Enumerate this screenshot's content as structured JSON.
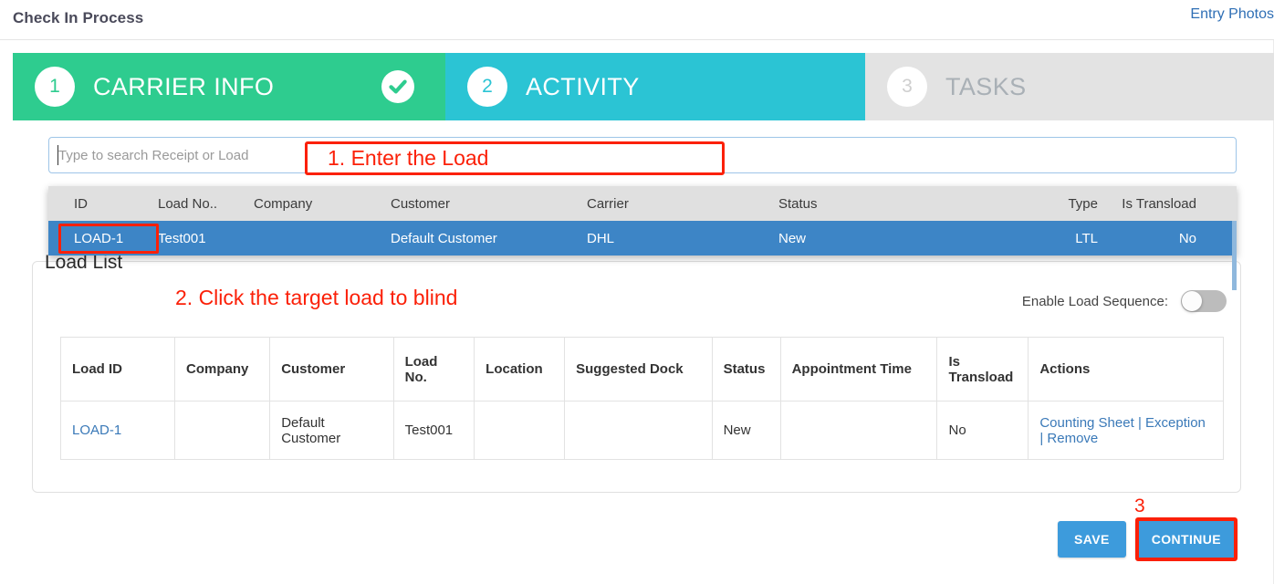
{
  "header": {
    "title": "Check In Process",
    "entry_photos_label": "Entry Photos"
  },
  "steps": [
    {
      "number": "1",
      "label": "CARRIER INFO",
      "state": "completed",
      "color": "#2ecc8f",
      "check_icon": "check-circle-icon"
    },
    {
      "number": "2",
      "label": "ACTIVITY",
      "state": "active",
      "color": "#2bc4d4"
    },
    {
      "number": "3",
      "label": "TASKS",
      "state": "inactive",
      "color": "#e3e3e3"
    }
  ],
  "search": {
    "placeholder": "Type to search Receipt or Load",
    "value": ""
  },
  "suggestions": {
    "columns": [
      "ID",
      "Load No..",
      "Company",
      "Customer",
      "Carrier",
      "Status",
      "Type",
      "Is Transload"
    ],
    "rows": [
      {
        "id": "LOAD-1",
        "load_no": "Test001",
        "company": "",
        "customer": "Default Customer",
        "carrier": "DHL",
        "status": "New",
        "type": "LTL",
        "is_transload": "No",
        "selected": true
      }
    ]
  },
  "load_list": {
    "title": "Load List",
    "toggle_label": "Enable Load Sequence:",
    "toggle_state": "off",
    "columns": [
      "Load ID",
      "Company",
      "Customer",
      "Load No.",
      "Location",
      "Suggested Dock",
      "Status",
      "Appointment Time",
      "Is Transload",
      "Actions"
    ],
    "rows": [
      {
        "load_id": "LOAD-1",
        "company": "",
        "customer": "Default Customer",
        "load_no": "Test001",
        "location": "",
        "suggested_dock": "",
        "status": "New",
        "appointment_time": "",
        "is_transload": "No",
        "actions": [
          "Counting Sheet",
          "Exception",
          "Remove"
        ],
        "action_separator": "|"
      }
    ]
  },
  "footer": {
    "save_label": "SAVE",
    "continue_label": "CONTINUE"
  },
  "annotations": {
    "step1": "1. Enter the Load",
    "step2": "2. Click the target load to blind",
    "step3": "3",
    "color": "#fb2008"
  }
}
